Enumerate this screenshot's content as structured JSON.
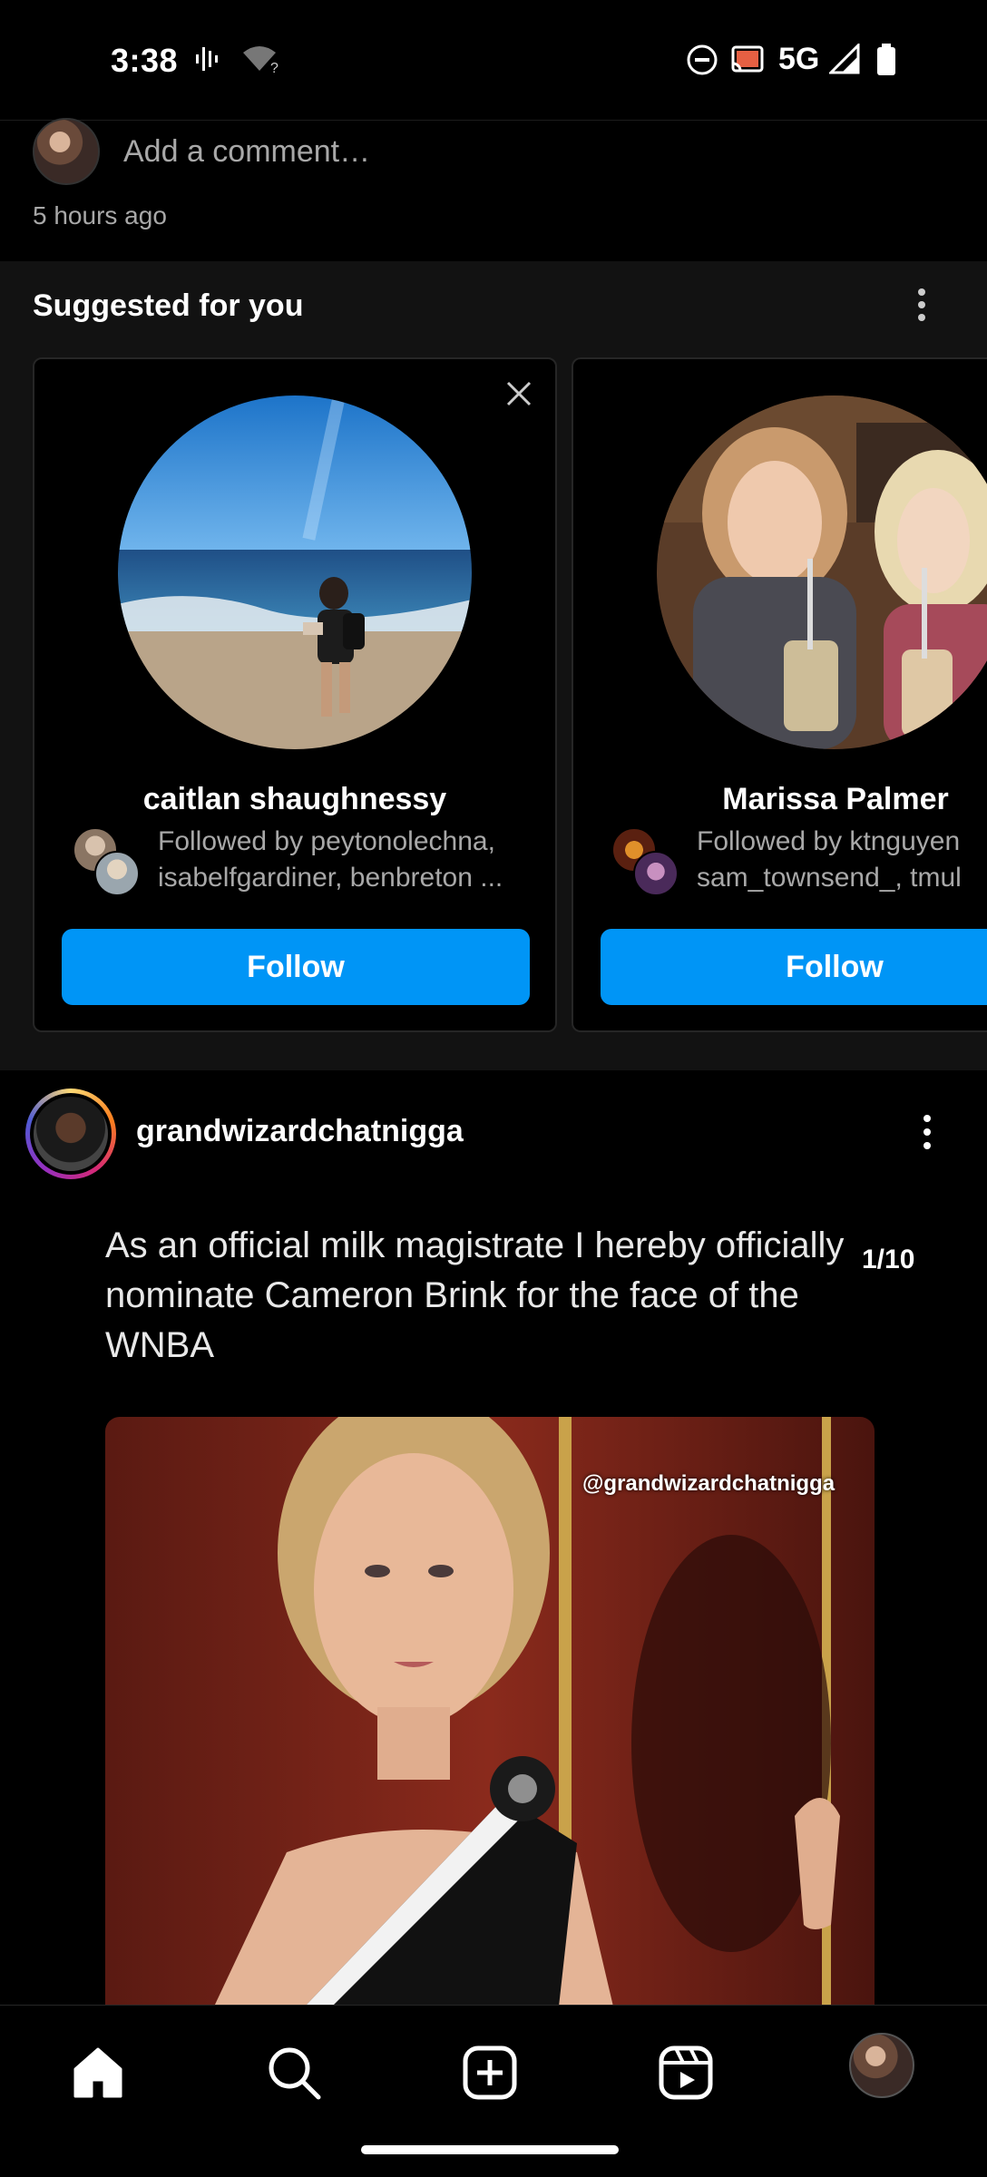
{
  "status_bar": {
    "time": "3:38",
    "network": "5G"
  },
  "comment": {
    "placeholder": "Add a comment…",
    "post_time": "5 hours ago"
  },
  "suggested": {
    "title": "Suggested for you",
    "cards": [
      {
        "name": "caitlan shaughnessy",
        "followed_line1": "Followed by peytonolechna,",
        "followed_line2": "isabelfgardiner, benbreton ...",
        "follow_label": "Follow"
      },
      {
        "name": "Marissa Palmer",
        "followed_line1": "Followed by ktnguyen",
        "followed_line2": "sam_townsend_, tmul",
        "follow_label": "Follow"
      }
    ]
  },
  "post": {
    "username": "grandwizardchatnigga",
    "caption": "As an official milk magistrate I hereby officially nominate Cameron Brink for the face of the WNBA",
    "counter": "1/10",
    "watermark": "@grandwizardchatnigga"
  },
  "bottom_nav": {
    "items": [
      "home-icon",
      "search-icon",
      "create-post-icon",
      "reels-icon",
      "profile-avatar"
    ]
  },
  "colors": {
    "accent": "#0095f6",
    "background": "#000000",
    "secondary_text": "#a8a8a8"
  }
}
